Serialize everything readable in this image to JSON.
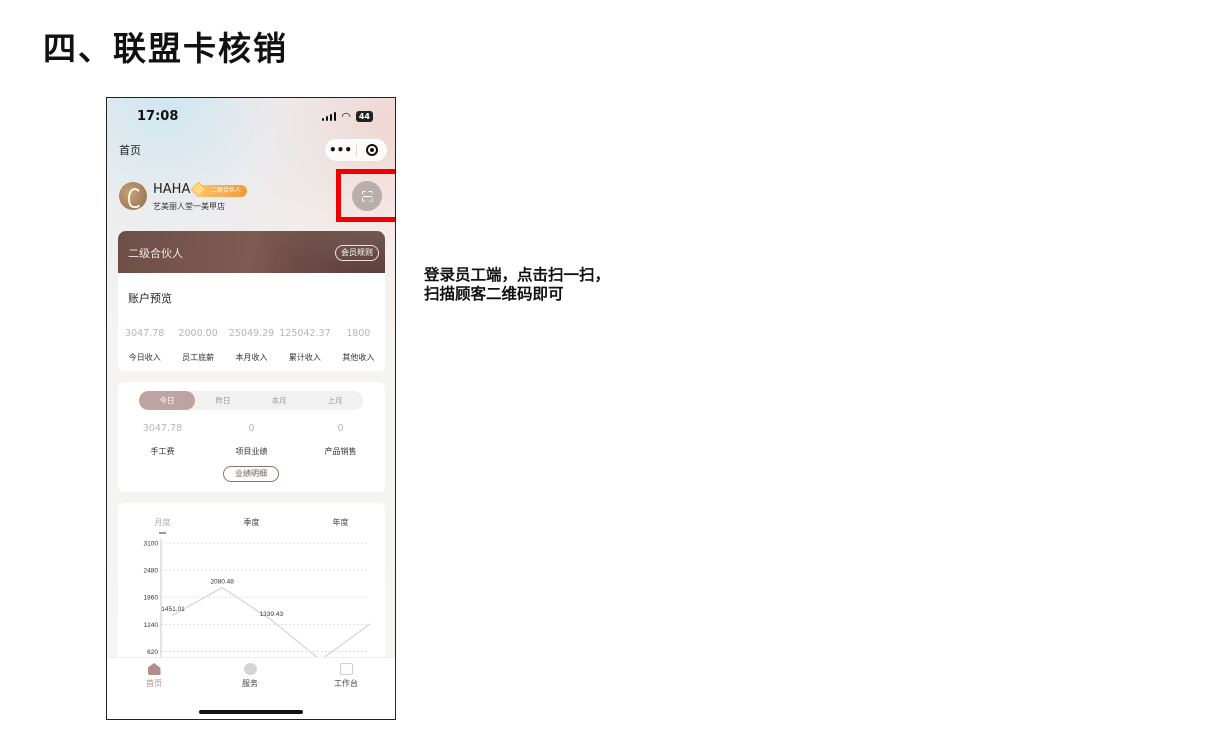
{
  "document": {
    "section_title": "四、联盟卡核销",
    "instruction_lines": [
      "登录员工端，点击扫一扫，",
      "扫描顾客二维码即可"
    ]
  },
  "status_bar": {
    "time": "17:08",
    "battery": "44"
  },
  "nav": {
    "title": "首页",
    "more": "•••"
  },
  "profile": {
    "name": "HAHA",
    "level_badge": "二级合伙人",
    "store": "艺美丽人堂一美甲店"
  },
  "member_card": {
    "level": "二级合伙人",
    "rules_button": "会员规则"
  },
  "account": {
    "title": "账户预览",
    "stats": [
      {
        "value": "3047.78",
        "label": "今日收入"
      },
      {
        "value": "2000.00",
        "label": "员工底薪"
      },
      {
        "value": "25049.29",
        "label": "本月收入"
      },
      {
        "value": "125042.37",
        "label": "累计收入"
      },
      {
        "value": "1800",
        "label": "其他收入"
      }
    ]
  },
  "performance": {
    "tabs": [
      "今日",
      "昨日",
      "本月",
      "上月"
    ],
    "active_tab": "今日",
    "stats": [
      {
        "value": "3047.78",
        "label": "手工费"
      },
      {
        "value": "0",
        "label": "项目业绩"
      },
      {
        "value": "0",
        "label": "产品销售"
      }
    ],
    "detail_button": "业绩明细"
  },
  "chart_tabs": [
    "月度",
    "季度",
    "年度"
  ],
  "chart_data": {
    "type": "line",
    "title": "",
    "xlabel": "",
    "ylabel": "",
    "yticks": [
      620,
      1240,
      1860,
      2480,
      3100
    ],
    "ylim": [
      0,
      3100
    ],
    "x": [
      1,
      2,
      3,
      4,
      5
    ],
    "values": [
      1451.01,
      2080.48,
      1339.43,
      420,
      1240
    ],
    "point_labels": [
      "1451.01",
      "2080.48",
      "1339.43",
      "",
      ""
    ],
    "grid": true,
    "line_color": "#d9d9d9"
  },
  "tab_bar": [
    {
      "label": "首页",
      "icon": "home-icon",
      "active": true
    },
    {
      "label": "服务",
      "icon": "service-icon",
      "active": false
    },
    {
      "label": "工作台",
      "icon": "workbench-icon",
      "active": false
    }
  ],
  "colors": {
    "highlight": "#ee0000",
    "accent": "#b08f8a",
    "card_dark": "#6e4f48"
  }
}
